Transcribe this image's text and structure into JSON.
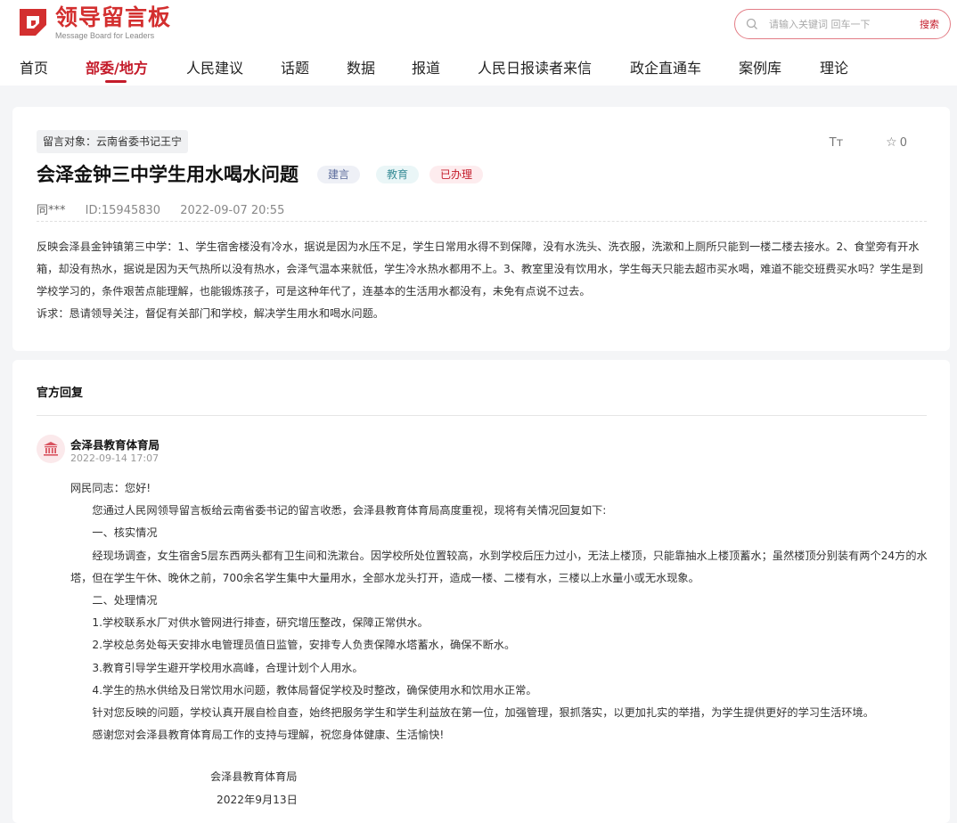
{
  "brand": {
    "title": "领导留言板",
    "subtitle": "Message Board for Leaders",
    "color": "#c41b2a"
  },
  "search": {
    "placeholder": "请输入关键词 回车一下",
    "button": "搜索",
    "icon": "search-icon"
  },
  "nav": {
    "items": [
      "首页",
      "部委/地方",
      "人民建议",
      "话题",
      "数据",
      "报道",
      "人民日报读者来信",
      "政企直通车",
      "案例库",
      "理论"
    ],
    "active_index": 1
  },
  "message": {
    "target": "留言对象：云南省委书记王宁",
    "title": "会泽金钟三中学生用水喝水问题",
    "tags": [
      "建言",
      "教育",
      "已办理"
    ],
    "author": "同***",
    "id": "ID:15945830",
    "datetime": "2022-09-07 20:55",
    "font_tool": "Tт",
    "fav_count": "0",
    "body": "反映会泽县金钟镇第三中学：1、学生宿舍楼没有冷水，据说是因为水压不足，学生日常用水得不到保障，没有水洗头、洗衣服，洗漱和上厕所只能到一楼二楼去接水。2、食堂旁有开水箱，却没有热水，据说是因为天气热所以没有热水，会泽气温本来就低，学生冷水热水都用不上。3、教室里没有饮用水，学生每天只能去超市买水喝，难道不能交班费买水吗？学生是到学校学习的，条件艰苦点能理解，也能锻炼孩子，可是这种年代了，连基本的生活用水都没有，未免有点说不过去。",
    "appeal": "诉求：恳请领导关注，督促有关部门和学校，解决学生用水和喝水问题。"
  },
  "reply": {
    "heading": "官方回复",
    "org": "会泽县教育体育局",
    "date": "2022-09-14 17:07",
    "greeting": "网民同志：您好!",
    "p1": "您通过人民网领导留言板给云南省委书记的留言收悉，会泽县教育体育局高度重视，现将有关情况回复如下:",
    "s1": "一、核实情况",
    "p2": "经现场调查，女生宿舍5层东西两头都有卫生间和洗漱台。因学校所处位置较高，水到学校后压力过小，无法上楼顶，只能靠抽水上楼顶蓄水；虽然楼顶分别装有两个24方的水塔，但在学生午休、晚休之前，700余名学生集中大量用水，全部水龙头打开，造成一楼、二楼有水，三楼以上水量小或无水现象。",
    "s2": "二、处理情况",
    "i1": "1.学校联系水厂对供水管网进行排查，研究增压整改，保障正常供水。",
    "i2": "2.学校总务处每天安排水电管理员值日监管，安排专人负责保障水塔蓄水，确保不断水。",
    "i3": "3.教育引导学生避开学校用水高峰，合理计划个人用水。",
    "i4": "4.学生的热水供给及日常饮用水问题，教体局督促学校及时整改，确保使用水和饮用水正常。",
    "p3": "针对您反映的问题，学校认真开展自检自查，始终把服务学生和学生利益放在第一位，加强管理，狠抓落实，以更加扎实的举措，为学生提供更好的学习生活环境。",
    "p4": "感谢您对会泽县教育体育局工作的支持与理解，祝您身体健康、生活愉快!",
    "sign_org": "会泽县教育体育局",
    "sign_date": "2022年9月13日"
  }
}
